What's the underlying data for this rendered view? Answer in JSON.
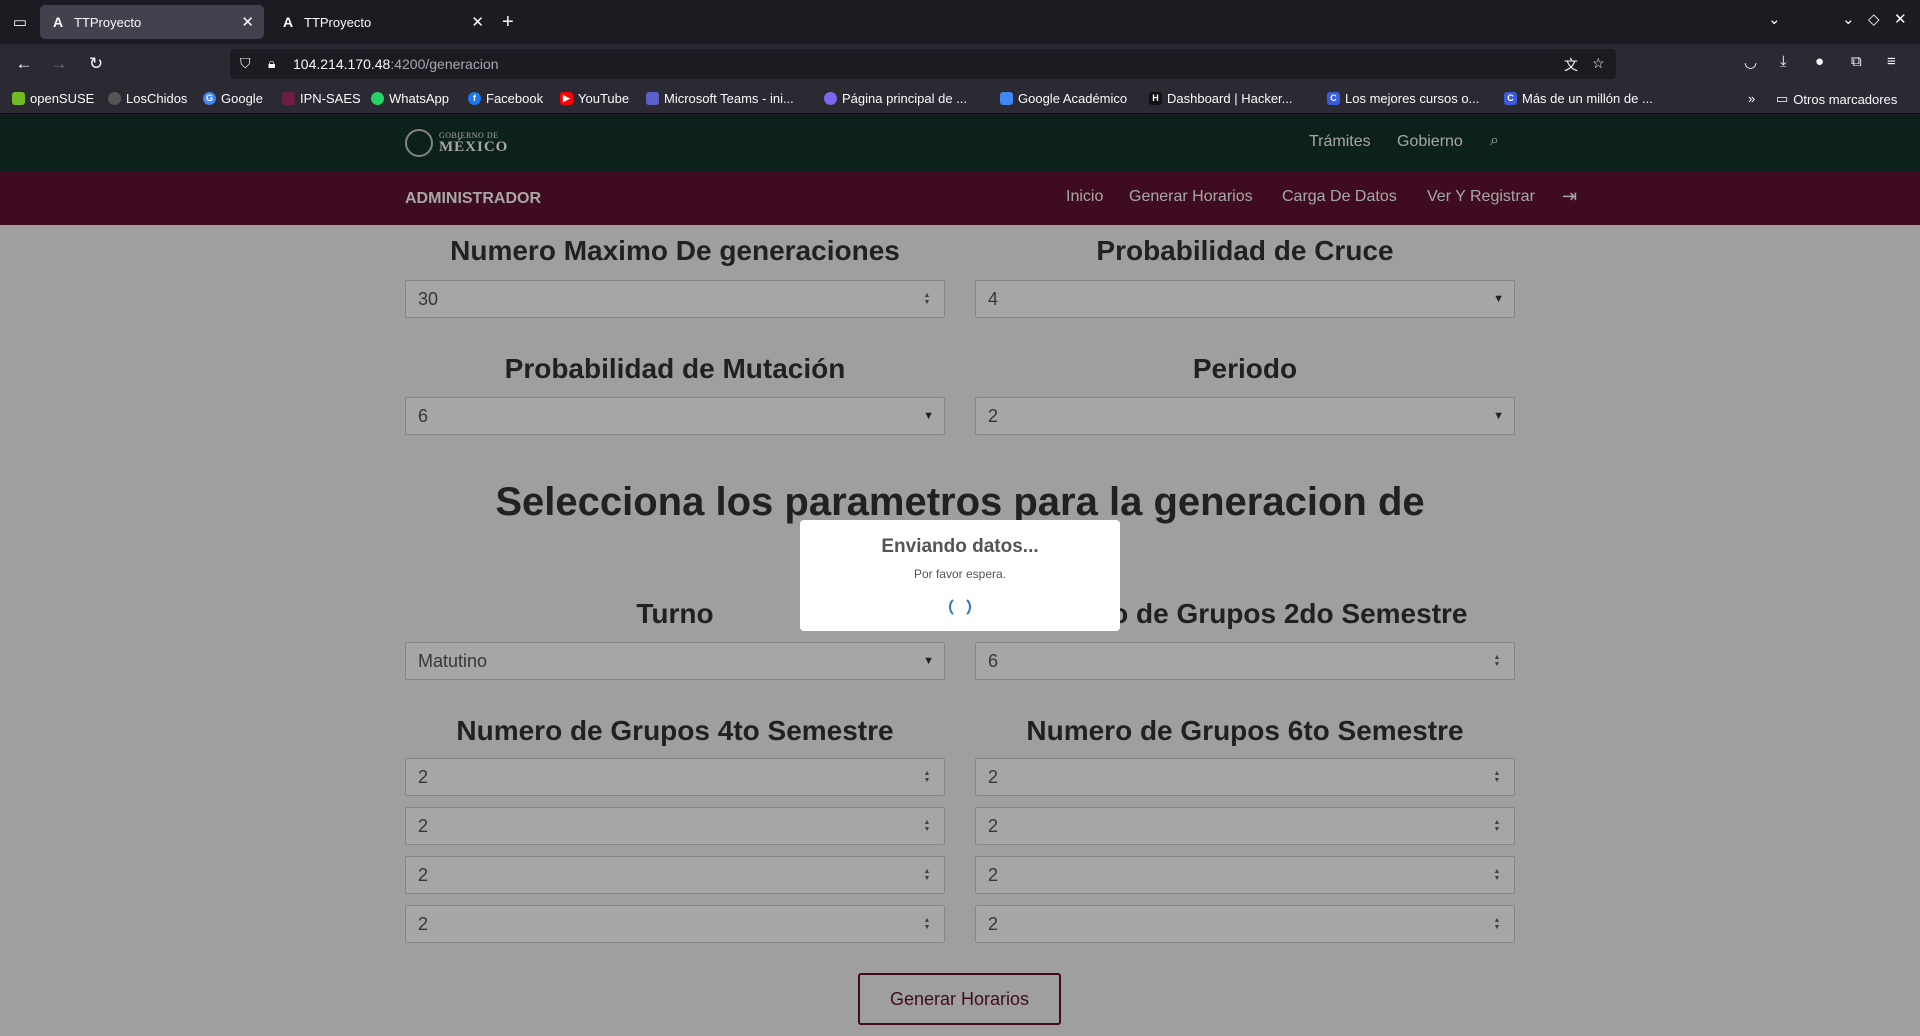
{
  "browser": {
    "tabs": [
      {
        "title": "TTProyecto",
        "favicon": "A",
        "active": true
      },
      {
        "title": "TTProyecto",
        "favicon": "A",
        "active": false
      }
    ],
    "url_host": "104.214.170.48",
    "url_path": ":4200/generacion",
    "bookmarks": [
      {
        "label": "openSUSE",
        "color": "#73ba25"
      },
      {
        "label": "LosChidos",
        "color": "#555555"
      },
      {
        "label": "Google",
        "color": "#4285f4"
      },
      {
        "label": "IPN-SAES",
        "color": "#6c1d45"
      },
      {
        "label": "WhatsApp",
        "color": "#25d366"
      },
      {
        "label": "Facebook",
        "color": "#1877f2"
      },
      {
        "label": "YouTube",
        "color": "#ff0000"
      },
      {
        "label": "Microsoft Teams - ini...",
        "color": "#5b5fc7"
      },
      {
        "label": "Página principal de ...",
        "color": "#7b68ee"
      },
      {
        "label": "Google Académico",
        "color": "#4285f4"
      },
      {
        "label": "Dashboard | Hacker...",
        "color": "#111111"
      },
      {
        "label": "Los mejores cursos o...",
        "color": "#3b5bdb"
      },
      {
        "label": "Más de un millón de ...",
        "color": "#3b5bdb"
      }
    ],
    "other_bookmarks": "Otros marcadores"
  },
  "gob": {
    "logo_top": "GOBIERNO DE",
    "logo_main": "MÉXICO",
    "links": [
      "Trámites",
      "Gobierno"
    ]
  },
  "admin": {
    "title": "ADMINISTRADOR",
    "links": [
      "Inicio",
      "Generar Horarios",
      "Carga De Datos",
      "Ver Y Registrar"
    ]
  },
  "form": {
    "max_generations": {
      "label": "Numero Maximo De generaciones",
      "value": "30"
    },
    "crossover": {
      "label": "Probabilidad de Cruce",
      "value": "4"
    },
    "mutation": {
      "label": "Probabilidad de Mutación",
      "value": "6"
    },
    "period": {
      "label": "Periodo",
      "value": "2"
    },
    "heading": "Selecciona los parametros para la generacion de",
    "shift": {
      "label": "Turno",
      "value": "Matutino"
    },
    "groups_2": {
      "label": "Numero de Grupos 2do Semestre",
      "value": "6"
    },
    "groups_4": {
      "label": "Numero de Grupos 4to Semestre",
      "values": [
        "2",
        "2",
        "2",
        "2"
      ]
    },
    "groups_6": {
      "label": "Numero de Grupos 6to Semestre",
      "values": [
        "2",
        "2",
        "2",
        "2"
      ]
    },
    "submit": "Generar Horarios"
  },
  "modal": {
    "title": "Enviando datos...",
    "subtitle": "Por favor espera."
  },
  "colors": {
    "gov_green": "#13322b",
    "gov_maroon": "#611232",
    "spinner": "#2778c4"
  }
}
